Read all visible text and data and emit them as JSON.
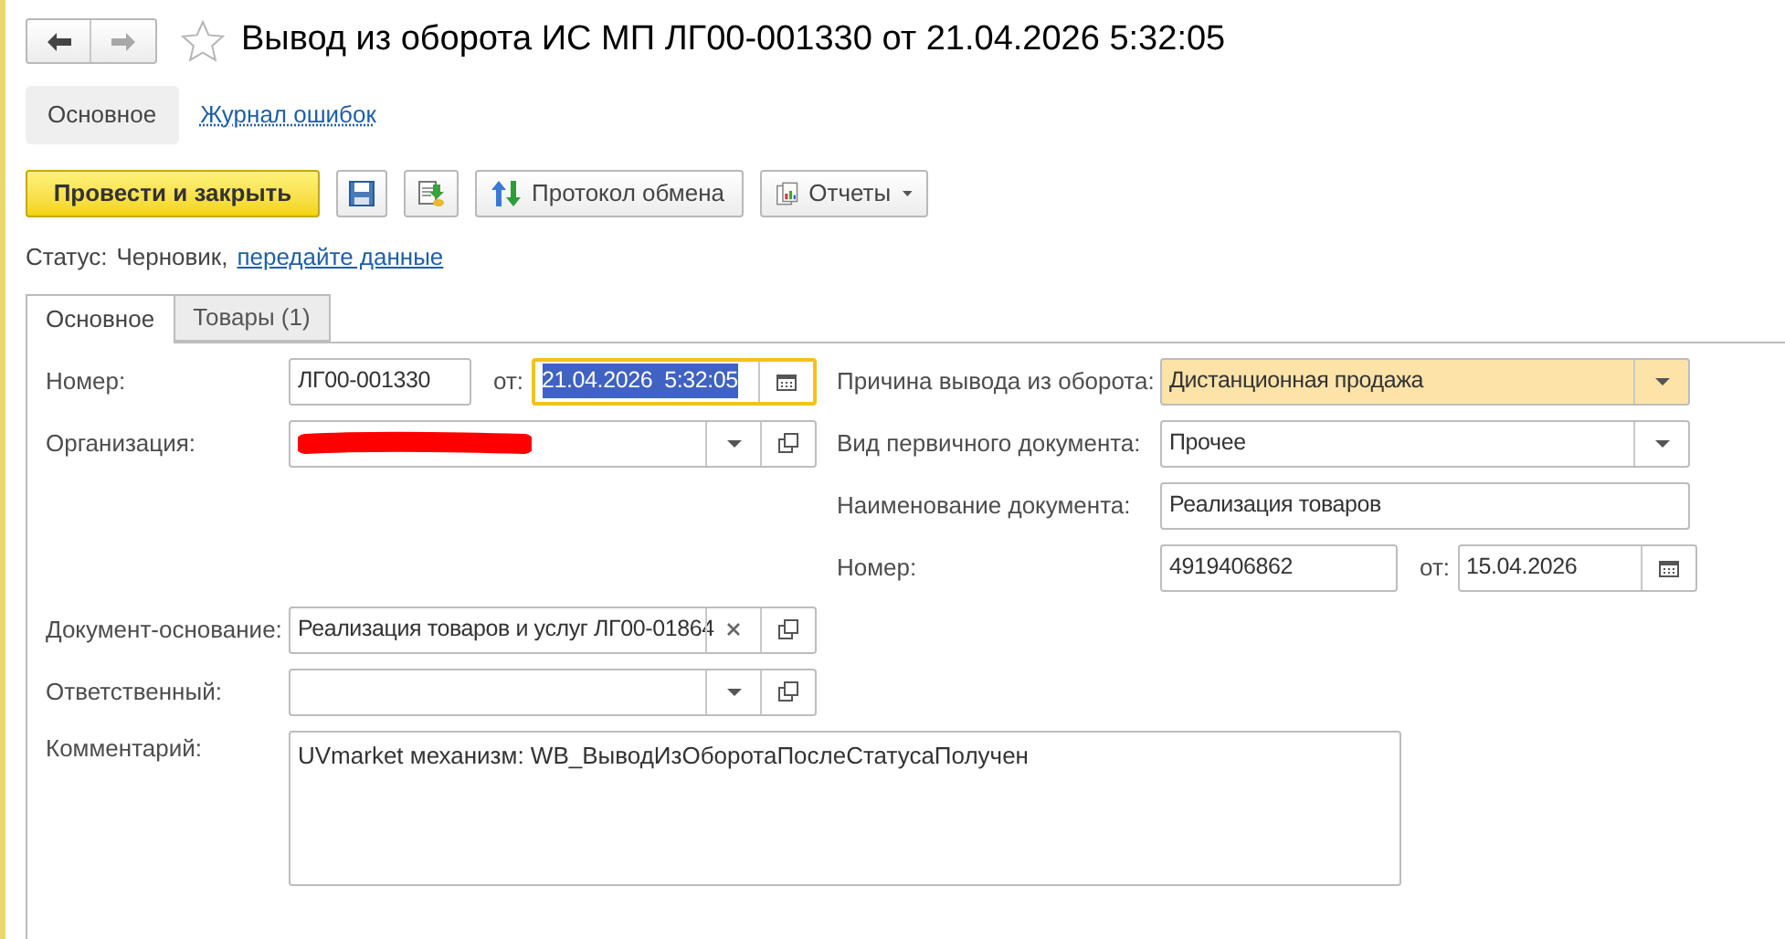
{
  "window": {
    "title": "Вывод из оборота ИС МП ЛГ00-001330 от 21.04.2026 5:32:05",
    "favorite": false
  },
  "nav": {
    "back_disabled": false,
    "forward_disabled": true
  },
  "sections": [
    {
      "label": "Основное",
      "selected": true
    },
    {
      "label": "Журнал ошибок",
      "selected": false
    }
  ],
  "toolbar": [
    {
      "kind": "primary",
      "label": "Провести и закрыть"
    },
    {
      "kind": "save"
    },
    {
      "kind": "post"
    },
    {
      "kind": "exchange",
      "label": "Протокол обмена"
    },
    {
      "kind": "reports",
      "label": "Отчеты"
    }
  ],
  "status": {
    "label": "Статус:",
    "value": "Черновик,",
    "link": "передайте данные"
  },
  "tabs": [
    {
      "label": "Основное",
      "selected": true
    },
    {
      "label": "Товары (1)",
      "selected": false
    }
  ],
  "main_left": [
    {
      "kind": "number_date",
      "label": "Номер:",
      "value": "ЛГ00-001330",
      "date_label": "от:",
      "date_value": "21.04.2026  5:32:05",
      "date_focused": true
    },
    {
      "kind": "select_link",
      "label": "Организация:",
      "redacted": true
    }
  ],
  "main_right": [
    {
      "kind": "select",
      "label": "Причина вывода из оборота:",
      "value": "Дистанционная продажа",
      "highlighted": true
    },
    {
      "kind": "select",
      "label": "Вид первичного документа:",
      "value": "Прочее",
      "highlighted": false
    },
    {
      "kind": "text",
      "label": "Наименование документа:",
      "value": "Реализация товаров",
      "highlighted": false
    },
    {
      "kind": "number_date",
      "label": "Номер:",
      "value": "4919406862",
      "date_label": "от:",
      "date_value": "15.04.2026",
      "date_focused": false
    }
  ],
  "lower": [
    {
      "kind": "reference",
      "label": "Документ-основание:",
      "value": "Реализация товаров и услуг ЛГ00-01864"
    },
    {
      "kind": "select_link",
      "label": "Ответственный:"
    },
    {
      "kind": "textarea",
      "label": "Комментарий:",
      "value": "UVmarket механизм: WB_ВыводИзОборотаПослеСтатусаПолучен"
    }
  ]
}
